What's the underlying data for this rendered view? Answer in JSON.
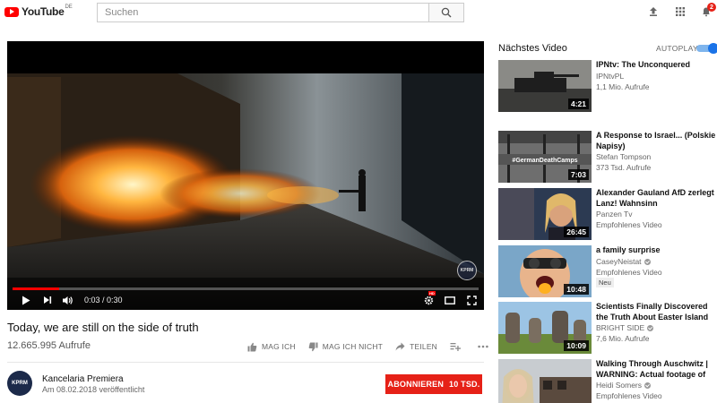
{
  "header": {
    "logo_text": "YouTube",
    "region": "DE",
    "search_placeholder": "Suchen",
    "notification_count": "2",
    "icons": [
      "upload-icon",
      "apps-icon",
      "notifications-icon"
    ]
  },
  "player": {
    "time": "0:03 / 0:30",
    "progress": 0.1,
    "watermark": "KPRM",
    "accent": "#ff0000"
  },
  "video": {
    "title": "Today, we are still on the side of truth",
    "views": "12.665.995 Aufrufe",
    "actions": {
      "like": "MAG ICH",
      "dislike": "MAG ICH NICHT",
      "share": "TEILEN"
    }
  },
  "channel": {
    "avatar_text": "KPRM",
    "name": "Kancelaria Premiera",
    "published": "Am 08.02.2018 veröffentlicht",
    "subscribe_label": "ABONNIEREN",
    "subscriber_count": "10 TSD."
  },
  "sidebar": {
    "up_next": "Nächstes Video",
    "autoplay_label": "AUTOPLAY",
    "autoplay_on": true,
    "items": [
      {
        "title": "IPNtv: The Unconquered",
        "channel": "IPNtvPL",
        "meta": "1,1 Mio. Aufrufe",
        "duration": "4:21",
        "verified": false
      },
      {
        "title": "A Response to Israel... (Polskie Napisy)",
        "channel": "Stefan Tompson",
        "meta": "373 Tsd. Aufrufe",
        "duration": "7:03",
        "verified": false,
        "thumb_text": "#GermanDeathCamps"
      },
      {
        "title": "Alexander Gauland AfD zerlegt Lanz! Wahnsinn",
        "channel": "Panzen Tv",
        "meta": "Empfohlenes Video",
        "duration": "26:45",
        "verified": false
      },
      {
        "title": "a family surprise",
        "channel": "CaseyNeistat",
        "meta": "Empfohlenes Video",
        "duration": "10:48",
        "verified": true,
        "badge": "Neu"
      },
      {
        "title": "Scientists Finally Discovered the Truth About Easter Island",
        "channel": "BRIGHT SIDE",
        "meta": "7,6 Mio. Aufrufe",
        "duration": "10:09",
        "verified": true
      },
      {
        "title": "Walking Through Auschwitz | WARNING: Actual footage of",
        "channel": "Heidi Somers",
        "meta": "Empfohlenes Video",
        "duration": "",
        "verified": true
      }
    ]
  }
}
